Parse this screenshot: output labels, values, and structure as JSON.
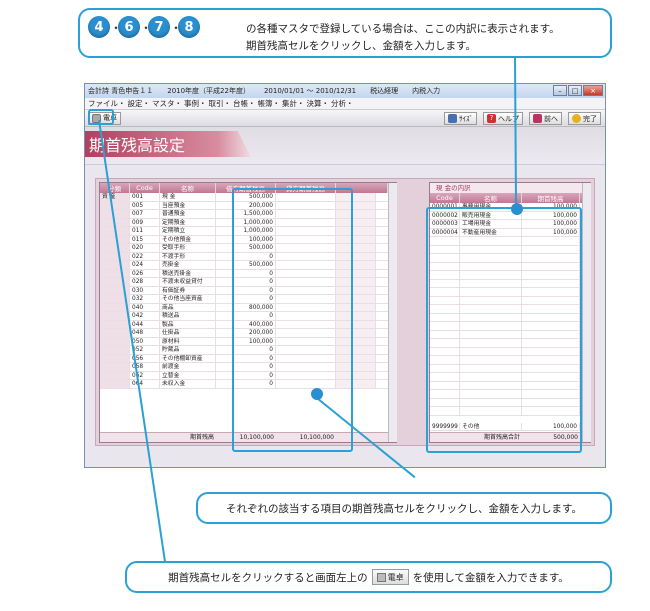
{
  "callout_top": {
    "badges": [
      "4",
      "6",
      "7",
      "8"
    ],
    "separator": "・",
    "line1": "の各種マスタで登録している場合は、ここの内訳に表示されます。",
    "line2": "期首残高セルをクリックし、金額を入力します。"
  },
  "callout_mid": {
    "text": "それぞれの該当する項目の期首残高セルをクリックし、金額を入力します。"
  },
  "callout_bot": {
    "text_before": "期首残高セルをクリックすると画面左上の",
    "button_label": "電卓",
    "text_after": "を使用して金額を入力できます。"
  },
  "window": {
    "title_parts": [
      "会計詩 青色申告１１",
      "2010年度（平成22年度）",
      "2010/01/01 ～ 2010/12/31",
      "税込経理",
      "内税入力"
    ],
    "menu": [
      "ファイル・",
      "設定・",
      "マスタ・",
      "事例・",
      "取引・",
      "台帳・",
      "帳簿・",
      "集計・",
      "決算・",
      "分析・"
    ],
    "toolbar_left": "電卓",
    "toolbar_right": [
      "ｻｲｽﾞ",
      "ヘルプ",
      "前へ",
      "完了"
    ],
    "heading": "期首残高設定"
  },
  "left_table": {
    "headers": [
      "分類",
      "Code",
      "名称",
      "借方期首残高",
      "貸方期首残高"
    ],
    "category": "資 産",
    "rows": [
      [
        "001",
        "現 金",
        "500,000"
      ],
      [
        "005",
        "当座預金",
        "200,000"
      ],
      [
        "007",
        "普通預金",
        "1,500,000"
      ],
      [
        "009",
        "定期預金",
        "1,000,000"
      ],
      [
        "011",
        "定期積立",
        "1,000,000"
      ],
      [
        "015",
        "その他預金",
        "100,000"
      ],
      [
        "020",
        "受取手形",
        "500,000"
      ],
      [
        "022",
        "不渡手形",
        "0"
      ],
      [
        "024",
        "売掛金",
        "500,000"
      ],
      [
        "026",
        "積送売掛金",
        "0"
      ],
      [
        "028",
        "不渡未収益貸付",
        "0"
      ],
      [
        "030",
        "有価証券",
        "0"
      ],
      [
        "032",
        "その他当座資産",
        "0"
      ],
      [
        "040",
        "商品",
        "800,000"
      ],
      [
        "042",
        "積送品",
        "0"
      ],
      [
        "044",
        "製品",
        "400,000"
      ],
      [
        "048",
        "仕掛品",
        "200,000"
      ],
      [
        "050",
        "原材料",
        "100,000"
      ],
      [
        "052",
        "貯蔵品",
        "0"
      ],
      [
        "056",
        "その他棚卸資産",
        "0"
      ],
      [
        "058",
        "前渡金",
        "0"
      ],
      [
        "062",
        "立替金",
        "0"
      ],
      [
        "064",
        "未収入金",
        "0"
      ]
    ],
    "footer_label": "期首残高",
    "footer_debit": "10,100,000",
    "footer_credit": "10,100,000"
  },
  "right_table": {
    "title": "現 金の内訳",
    "headers": [
      "Code",
      "名称",
      "期首残高"
    ],
    "rows": [
      [
        "0000001",
        "事務用現金",
        "100,000"
      ],
      [
        "0000002",
        "販売用現金",
        "100,000"
      ],
      [
        "0000003",
        "工場用現金",
        "100,000"
      ],
      [
        "0000004",
        "不動産用現金",
        "100,000"
      ]
    ],
    "other_row": [
      "9999999",
      "その他",
      "100,000"
    ],
    "footer_label": "期首残高合計",
    "footer_value": "500,000"
  },
  "colors": {
    "callout": "#2aa0d6",
    "badge": "#2a8fd0",
    "heading": "#b04060"
  }
}
